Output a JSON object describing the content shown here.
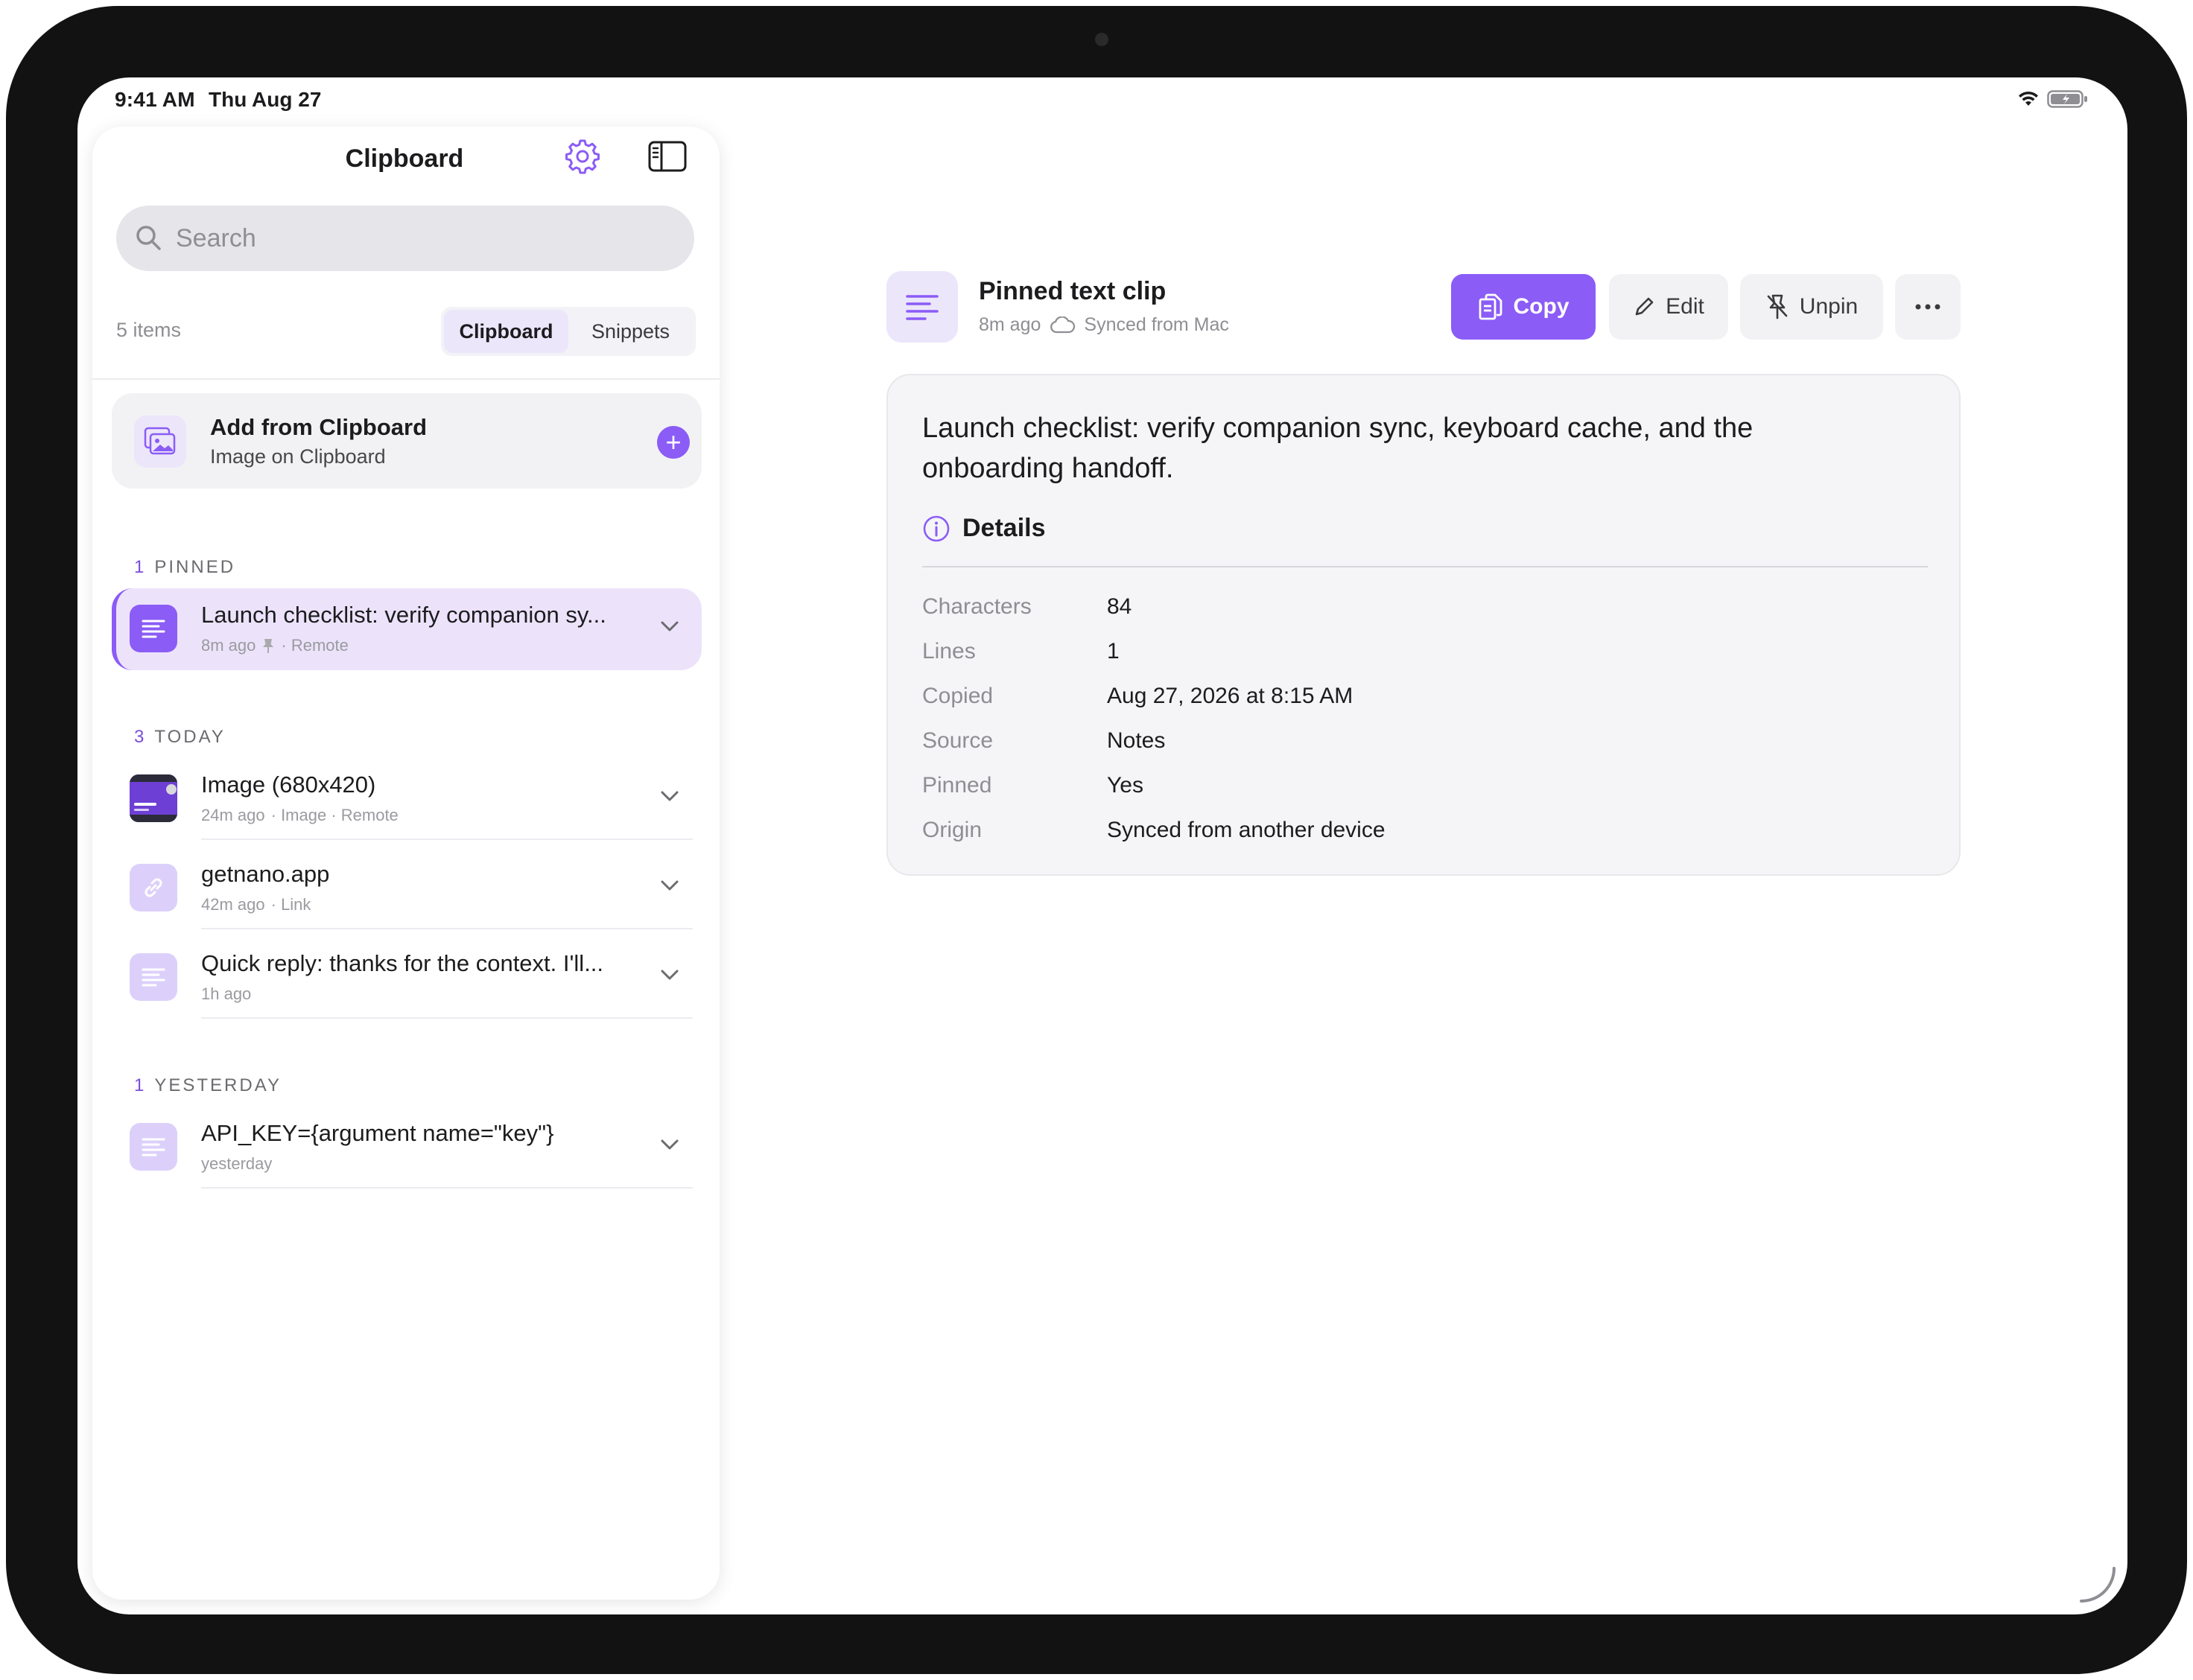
{
  "status_bar": {
    "time": "9:41 AM",
    "date": "Thu Aug 27"
  },
  "sidebar": {
    "title": "Clipboard",
    "search_placeholder": "Search",
    "count_label": "5 items",
    "tabs": [
      {
        "label": "Clipboard",
        "active": true
      },
      {
        "label": "Snippets",
        "active": false
      }
    ],
    "add_card": {
      "title": "Add from Clipboard",
      "subtitle": "Image on Clipboard"
    },
    "sections": [
      {
        "count": "1",
        "label": "PINNED"
      },
      {
        "count": "3",
        "label": "TODAY"
      },
      {
        "count": "1",
        "label": "YESTERDAY"
      }
    ],
    "items": [
      {
        "title": "Launch checklist: verify companion sy...",
        "time": "8m ago",
        "tags": "· Remote",
        "icon": "text-lines-icon",
        "pinned": true
      },
      {
        "title": "Image (680x420)",
        "time": "24m ago",
        "tags": "· Image  · Remote",
        "icon": "image-thumbnail"
      },
      {
        "title": "getnano.app",
        "time": "42m ago",
        "tags": "· Link",
        "icon": "link-icon"
      },
      {
        "title": "Quick reply: thanks for the context. I'll...",
        "time": "1h ago",
        "tags": "",
        "icon": "text-lines-icon"
      },
      {
        "title": "API_KEY={argument name=\"key\"}",
        "time": "yesterday",
        "tags": "",
        "icon": "text-lines-icon"
      }
    ]
  },
  "detail": {
    "title": "Pinned text clip",
    "time": "8m ago",
    "sync": "Synced from Mac",
    "buttons": {
      "copy": "Copy",
      "edit": "Edit",
      "unpin": "Unpin"
    },
    "body": "Launch checklist: verify companion sync, keyboard cache, and the onboarding handoff.",
    "details_heading": "Details",
    "fields": [
      {
        "key": "Characters",
        "value": "84"
      },
      {
        "key": "Lines",
        "value": "1"
      },
      {
        "key": "Copied",
        "value": "Aug 27, 2026 at 8:15 AM"
      },
      {
        "key": "Source",
        "value": "Notes"
      },
      {
        "key": "Pinned",
        "value": "Yes"
      },
      {
        "key": "Origin",
        "value": "Synced from another device"
      }
    ]
  },
  "colors": {
    "accent": "#8b5cf6",
    "accent_soft": "#ece6fb",
    "bezel": "#121212"
  }
}
